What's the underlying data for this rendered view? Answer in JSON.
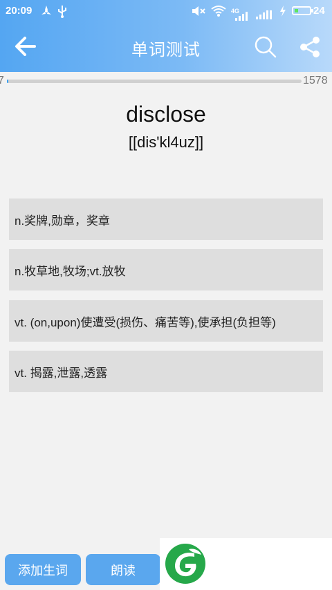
{
  "status_bar": {
    "time": "20:09",
    "network_label": "4G",
    "battery_percent": 24,
    "battery_text": "24"
  },
  "toolbar": {
    "title": "单词测试",
    "back_icon": "arrow-left-icon",
    "search_icon": "search-icon",
    "share_icon": "share-icon"
  },
  "progress": {
    "current": "7",
    "total": "1578"
  },
  "word": {
    "text": "disclose",
    "phonetic": "[[dis'kl4uz]]"
  },
  "options": [
    {
      "label": "n.奖牌,勋章，奖章"
    },
    {
      "label": "n.牧草地,牧场;vt.放牧"
    },
    {
      "label": "vt. (on,upon)使遭受(损伤、痛苦等),使承担(负担等)"
    },
    {
      "label": "vt. 揭露,泄露,透露"
    }
  ],
  "actions": {
    "add_word_label": "添加生词",
    "read_label": "朗读"
  },
  "colors": {
    "header_start": "#54a6f2",
    "header_end": "#b8d9fa",
    "button": "#5aa7ee",
    "option_bg": "#dedede",
    "battery": "#5ee65e",
    "logo_green": "#26a84a"
  }
}
